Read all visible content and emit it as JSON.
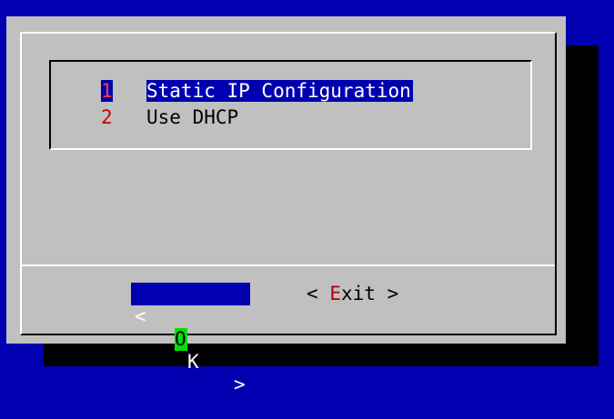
{
  "menu": {
    "items": [
      {
        "tag": "1",
        "label": "Static IP Configuration",
        "selected": true
      },
      {
        "tag": "2",
        "label": "Use DHCP",
        "selected": false
      }
    ]
  },
  "buttons": {
    "ok": {
      "left": "<",
      "hot": "O",
      "rest": "K",
      "right": ">",
      "focused": true
    },
    "exit": {
      "left": "<",
      "hot": "E",
      "rest": "xit",
      "right": ">",
      "focused": false
    }
  },
  "colors": {
    "screen_bg": "#0000b0",
    "dialog_bg": "#c0c0c0",
    "highlight_bg": "#0000b0",
    "hotkey": "#cc0000",
    "focus_key": "#00e000"
  }
}
